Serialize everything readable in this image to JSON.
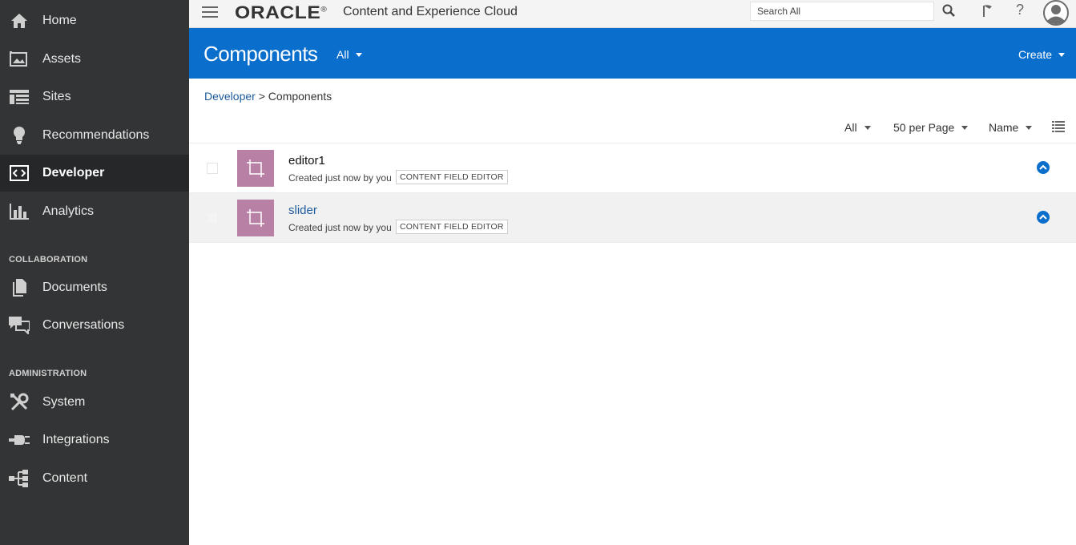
{
  "sidebar": {
    "items": [
      {
        "label": "Home",
        "icon": "home-icon"
      },
      {
        "label": "Assets",
        "icon": "assets-icon"
      },
      {
        "label": "Sites",
        "icon": "sites-icon"
      },
      {
        "label": "Recommendations",
        "icon": "lightbulb-icon"
      },
      {
        "label": "Developer",
        "icon": "developer-icon",
        "active": true
      },
      {
        "label": "Analytics",
        "icon": "analytics-icon"
      }
    ],
    "collaboration_heading": "COLLABORATION",
    "collaboration_items": [
      {
        "label": "Documents",
        "icon": "documents-icon"
      },
      {
        "label": "Conversations",
        "icon": "conversations-icon"
      }
    ],
    "administration_heading": "ADMINISTRATION",
    "administration_items": [
      {
        "label": "System",
        "icon": "tools-icon"
      },
      {
        "label": "Integrations",
        "icon": "plug-icon"
      },
      {
        "label": "Content",
        "icon": "content-tree-icon"
      }
    ]
  },
  "topbar": {
    "brand": "ORACLE",
    "brand_mark": "®",
    "app_title": "Content and Experience Cloud",
    "search_placeholder": "Search All",
    "help_label": "?"
  },
  "header": {
    "title": "Components",
    "filter": "All",
    "create_label": "Create"
  },
  "breadcrumb": {
    "parent": "Developer",
    "separator": ">",
    "current": "Components"
  },
  "toolbar": {
    "filter": "All",
    "per_page": "50 per Page",
    "sort": "Name"
  },
  "components": [
    {
      "name": "editor1",
      "meta": "Created just now by you",
      "tag": "CONTENT FIELD EDITOR"
    },
    {
      "name": "slider",
      "meta": "Created just now by you",
      "tag": "CONTENT FIELD EDITOR"
    }
  ],
  "colors": {
    "sidebar_bg": "#333435",
    "header_blue": "#0a6fcc",
    "thumb_pink": "#b980a6",
    "link_blue": "#1c5a9c"
  }
}
